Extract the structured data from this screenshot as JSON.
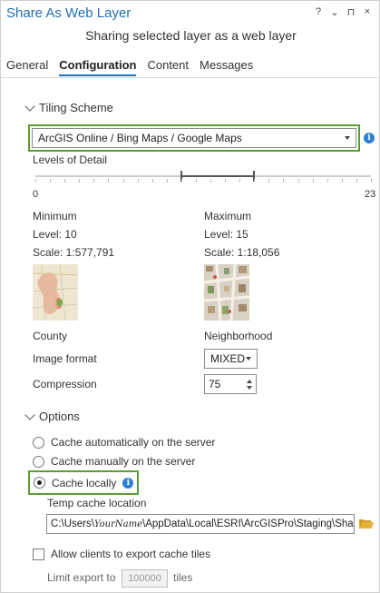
{
  "window": {
    "title": "Share As Web Layer",
    "controls": [
      "?",
      "⌄",
      "⊓",
      "×"
    ],
    "subtitle": "Sharing selected layer as a web layer"
  },
  "tabs": [
    {
      "label": "General",
      "active": false
    },
    {
      "label": "Configuration",
      "active": true
    },
    {
      "label": "Content",
      "active": false
    },
    {
      "label": "Messages",
      "active": false
    }
  ],
  "tiling": {
    "header": "Tiling Scheme",
    "scheme_value": "ArcGIS Online / Bing Maps / Google Maps",
    "levels_label": "Levels of Detail",
    "slider": {
      "min": 0,
      "max": 23,
      "low": 10,
      "high": 15,
      "min_label": "0",
      "max_label": "23"
    },
    "minimum": {
      "heading": "Minimum",
      "level": "Level:  10",
      "scale": "Scale:  1:577,791",
      "caption": "County"
    },
    "maximum": {
      "heading": "Maximum",
      "level": "Level:  15",
      "scale": "Scale:  1:18,056",
      "caption": "Neighborhood"
    },
    "image_format_label": "Image format",
    "image_format_value": "MIXED",
    "compression_label": "Compression",
    "compression_value": "75"
  },
  "options": {
    "header": "Options",
    "cache_auto": "Cache automatically on the server",
    "cache_manual": "Cache manually on the server",
    "cache_local": "Cache locally",
    "selected": "cache_local",
    "temp_label": "Temp cache location",
    "temp_user": "YourName",
    "temp_path_prefix": "C:\\Users\\",
    "temp_path_suffix": "\\AppData\\Local\\ESRI\\ArcGISPro\\Staging\\Sha",
    "allow_export": "Allow clients to export cache tiles",
    "limit_label": "Limit export to",
    "limit_value": "100000",
    "limit_unit": "tiles"
  },
  "colors": {
    "accent": "#1f6fb5",
    "highlight_border": "#5a9e33",
    "info": "#2f7fd0",
    "folder": "#e6b23a"
  }
}
